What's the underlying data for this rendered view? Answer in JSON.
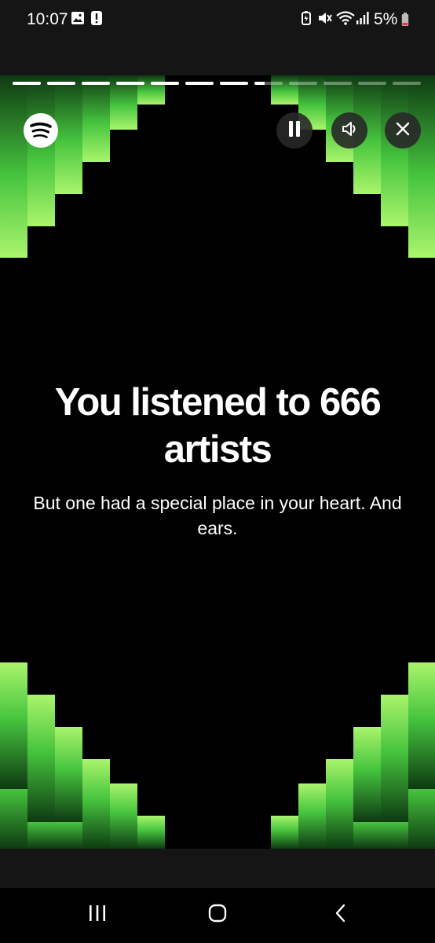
{
  "status_bar": {
    "time": "10:07",
    "battery_percent": "5%",
    "icons": [
      "image-icon",
      "alert-icon",
      "battery-saver-icon",
      "mute-icon",
      "wifi-icon",
      "signal-icon",
      "battery-low-icon"
    ]
  },
  "story": {
    "progress": {
      "segment_count": 12,
      "current_segment": 8,
      "current_segment_fill": 0.35
    },
    "headline": "You listened to 666 artists",
    "subtext": "But one had a special place in your heart. And ears.",
    "controls": [
      "pause-icon",
      "sound-icon",
      "close-icon"
    ],
    "colors": {
      "accent_green_light": "#aaf56c",
      "accent_green_mid": "#46c43e",
      "accent_green_dark": "#0e3a12",
      "background": "#000000"
    }
  },
  "nav_bar": {
    "buttons": [
      "recents-icon",
      "home-icon",
      "back-icon"
    ]
  }
}
